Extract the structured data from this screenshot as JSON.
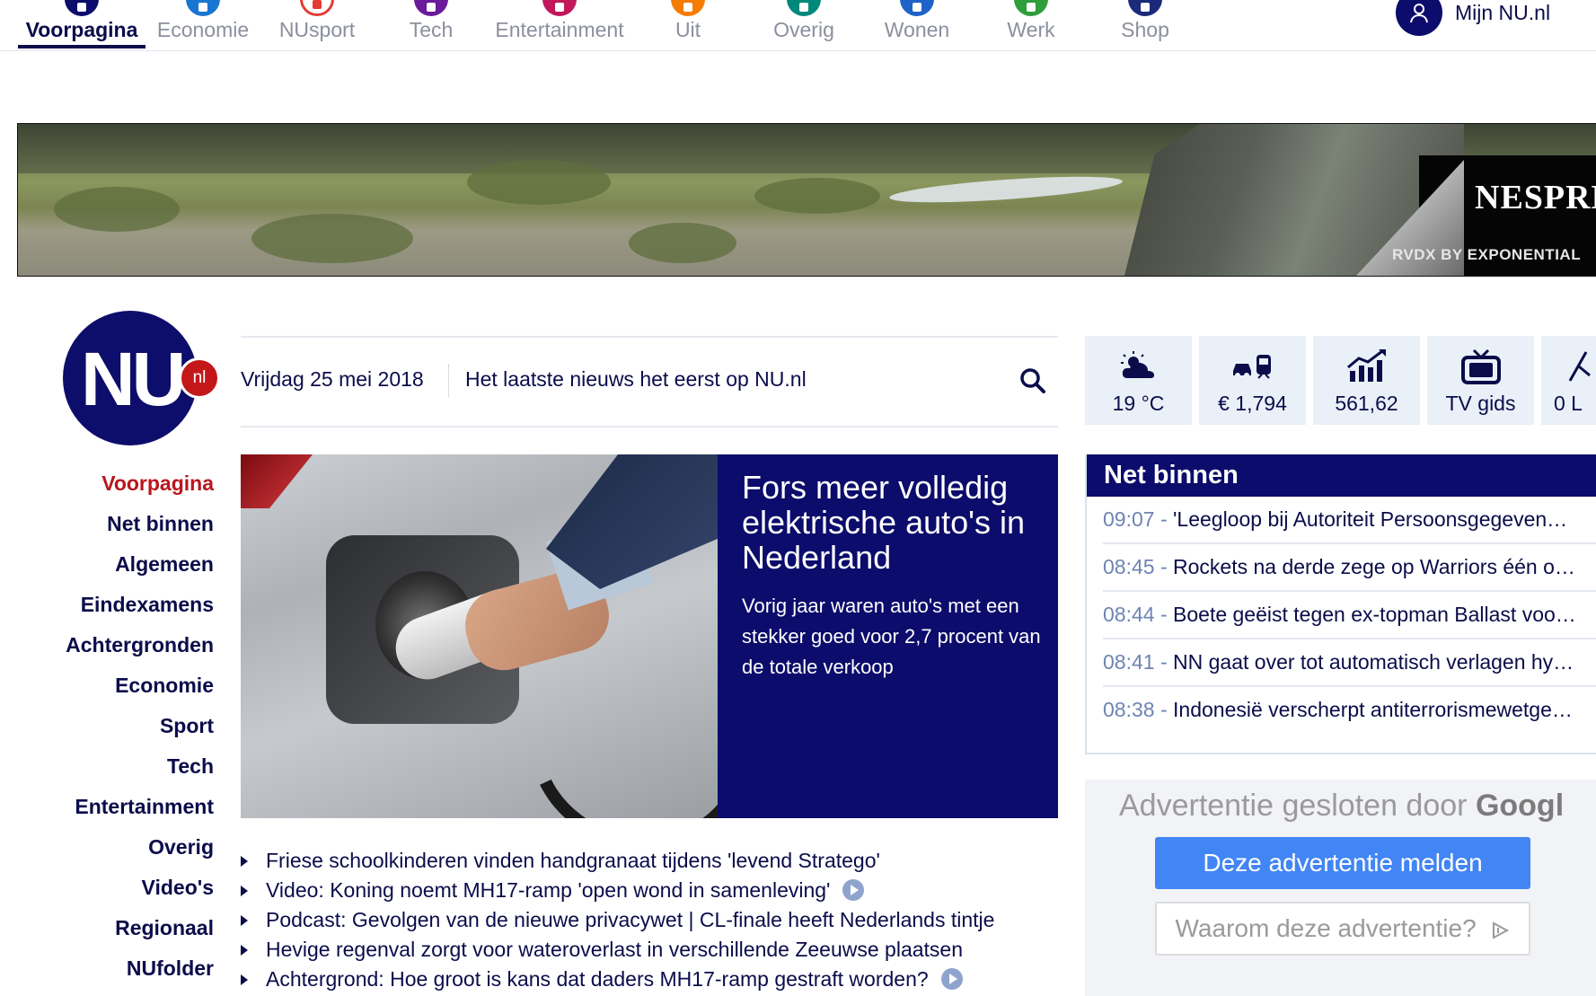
{
  "topnav": {
    "items": [
      {
        "label": "Voorpagina",
        "color": "#0b0c6b",
        "active": true
      },
      {
        "label": "Economie",
        "color": "#1a75d2"
      },
      {
        "label": "NUsport",
        "color": "#e53935"
      },
      {
        "label": "Tech",
        "color": "#6a1b9a"
      },
      {
        "label": "Entertainment",
        "color": "#c2185b"
      },
      {
        "label": "Uit",
        "color": "#f57c00"
      },
      {
        "label": "Overig",
        "color": "#00897b"
      },
      {
        "label": "Wonen",
        "color": "#1e63c7"
      },
      {
        "label": "Werk",
        "color": "#2e9e3d"
      },
      {
        "label": "Shop",
        "color": "#1b2a7a"
      }
    ],
    "account_label": "Mijn NU.nl"
  },
  "banner": {
    "brand": "NESPRESS",
    "vendor": "RVDX BY EXPONENTIAL"
  },
  "logo": {
    "text": "NU",
    "badge": "nl"
  },
  "sidenav": [
    "Voorpagina",
    "Net binnen",
    "Algemeen",
    "Eindexamens",
    "Achtergronden",
    "Economie",
    "Sport",
    "Tech",
    "Entertainment",
    "Overig",
    "Video's",
    "Regionaal",
    "NUfolder"
  ],
  "datebar": {
    "date": "Vrijdag 25 mei 2018",
    "slogan": "Het laatste nieuws het eerst op NU.nl"
  },
  "hero": {
    "title": "Fors meer volledig elektrische auto's in Nederland",
    "summary": "Vorig jaar waren auto's met een stekker goed voor 2,7 procent van de totale verkoop"
  },
  "headlines": [
    {
      "text": "Friese schoolkinderen vinden handgranaat tijdens 'levend Stratego'",
      "video": false
    },
    {
      "text": "Video: Koning noemt MH17-ramp 'open wond in samenleving'",
      "video": true
    },
    {
      "text": "Podcast: Gevolgen van de nieuwe privacywet | CL-finale heeft Nederlands tintje",
      "video": false
    },
    {
      "text": "Hevige regenval zorgt voor wateroverlast in verschillende Zeeuwse plaatsen",
      "video": false
    },
    {
      "text": "Achtergrond: Hoe groot is kans dat daders MH17-ramp gestraft worden?",
      "video": true
    }
  ],
  "widgets": [
    {
      "icon": "weather-icon",
      "value": "19 °C"
    },
    {
      "icon": "traffic-icon",
      "value": "€ 1,794"
    },
    {
      "icon": "stocks-icon",
      "value": "561,62"
    },
    {
      "icon": "tv-icon",
      "value": "TV gids"
    },
    {
      "icon": "lottery-icon",
      "value": "0 L"
    }
  ],
  "netbinnen": {
    "title": "Net binnen",
    "items": [
      {
        "time": "09:07",
        "text": "'Leegloop bij Autoriteit Persoonsgegeven…"
      },
      {
        "time": "08:45",
        "text": "Rockets na derde zege op Warriors één o…"
      },
      {
        "time": "08:44",
        "text": "Boete geëist tegen ex-topman Ballast voo…"
      },
      {
        "time": "08:41",
        "text": "NN gaat over tot automatisch verlagen hy…"
      },
      {
        "time": "08:38",
        "text": "Indonesië verscherpt antiterrorismewetge…"
      }
    ]
  },
  "googlead": {
    "closed_text": "Advertentie gesloten door",
    "google": "Googl",
    "report_label": "Deze advertentie melden",
    "why_label": "Waarom deze advertentie?"
  },
  "colors": {
    "navy": "#0b0c6b",
    "accent_red": "#b8161c",
    "google_blue": "#4285f4"
  }
}
